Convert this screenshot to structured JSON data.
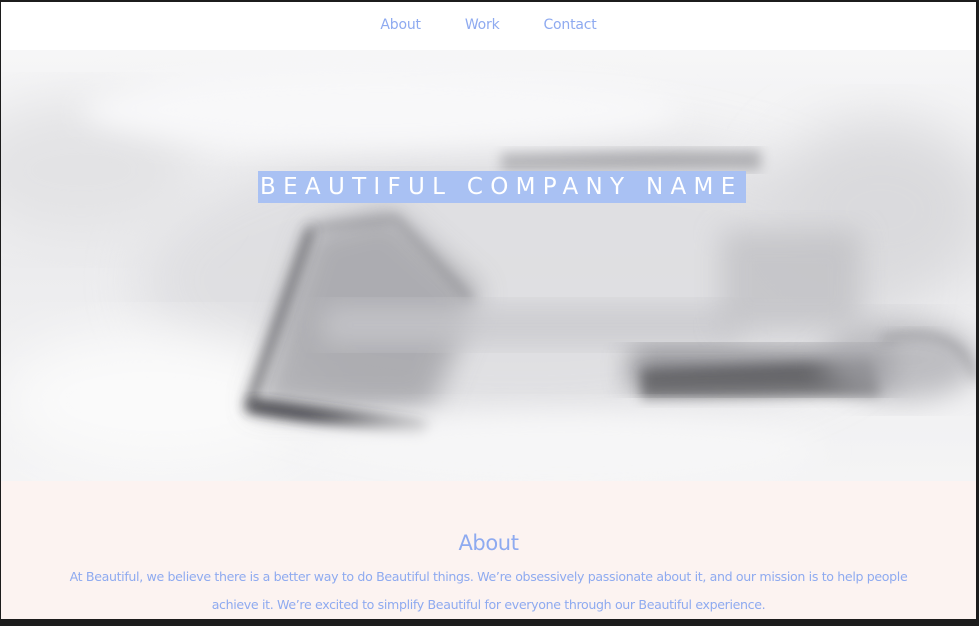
{
  "nav": {
    "items": [
      {
        "label": "About"
      },
      {
        "label": "Work"
      },
      {
        "label": "Contact"
      }
    ]
  },
  "hero": {
    "title": "BEAUTIFUL COMPANY NAME"
  },
  "about": {
    "heading": "About",
    "text": "At Beautiful, we believe there is a better way to do Beautiful things. We’re obsessively passionate about it, and our mission is to help people achieve it. We’re excited to simplify Beautiful for everyone through our Beautiful experience."
  },
  "colors": {
    "accent": "#8eaaf0",
    "title_highlight": "#a9c1f3",
    "about_background": "#fcf3f1",
    "page_border": "#1c1c1c"
  }
}
